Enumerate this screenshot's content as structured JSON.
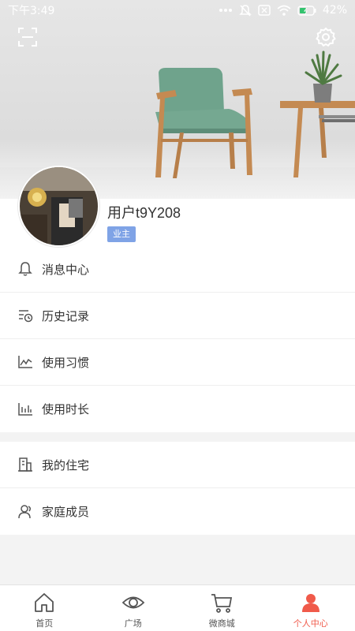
{
  "status_bar": {
    "time": "下午3:49",
    "battery": "42%"
  },
  "header": {
    "scan_icon": "scan-icon",
    "settings_icon": "gear-icon"
  },
  "profile": {
    "username": "用户t9Y208",
    "role": "业主"
  },
  "menu_group_1": [
    {
      "label": "消息中心",
      "icon": "bell-icon"
    },
    {
      "label": "历史记录",
      "icon": "history-icon"
    },
    {
      "label": "使用习惯",
      "icon": "line-chart-icon"
    },
    {
      "label": "使用时长",
      "icon": "bar-chart-icon"
    }
  ],
  "menu_group_2": [
    {
      "label": "我的住宅",
      "icon": "building-icon"
    },
    {
      "label": "家庭成员",
      "icon": "members-icon"
    }
  ],
  "bottom_nav": [
    {
      "label": "首页",
      "icon": "home-icon",
      "active": false
    },
    {
      "label": "广场",
      "icon": "eye-icon",
      "active": false
    },
    {
      "label": "微商城",
      "icon": "cart-icon",
      "active": false
    },
    {
      "label": "个人中心",
      "icon": "person-icon",
      "active": true
    }
  ],
  "colors": {
    "accent": "#f05a4a",
    "badge": "#7fa3e6",
    "chair_seat": "#6fa38c",
    "wood": "#c48a52"
  }
}
